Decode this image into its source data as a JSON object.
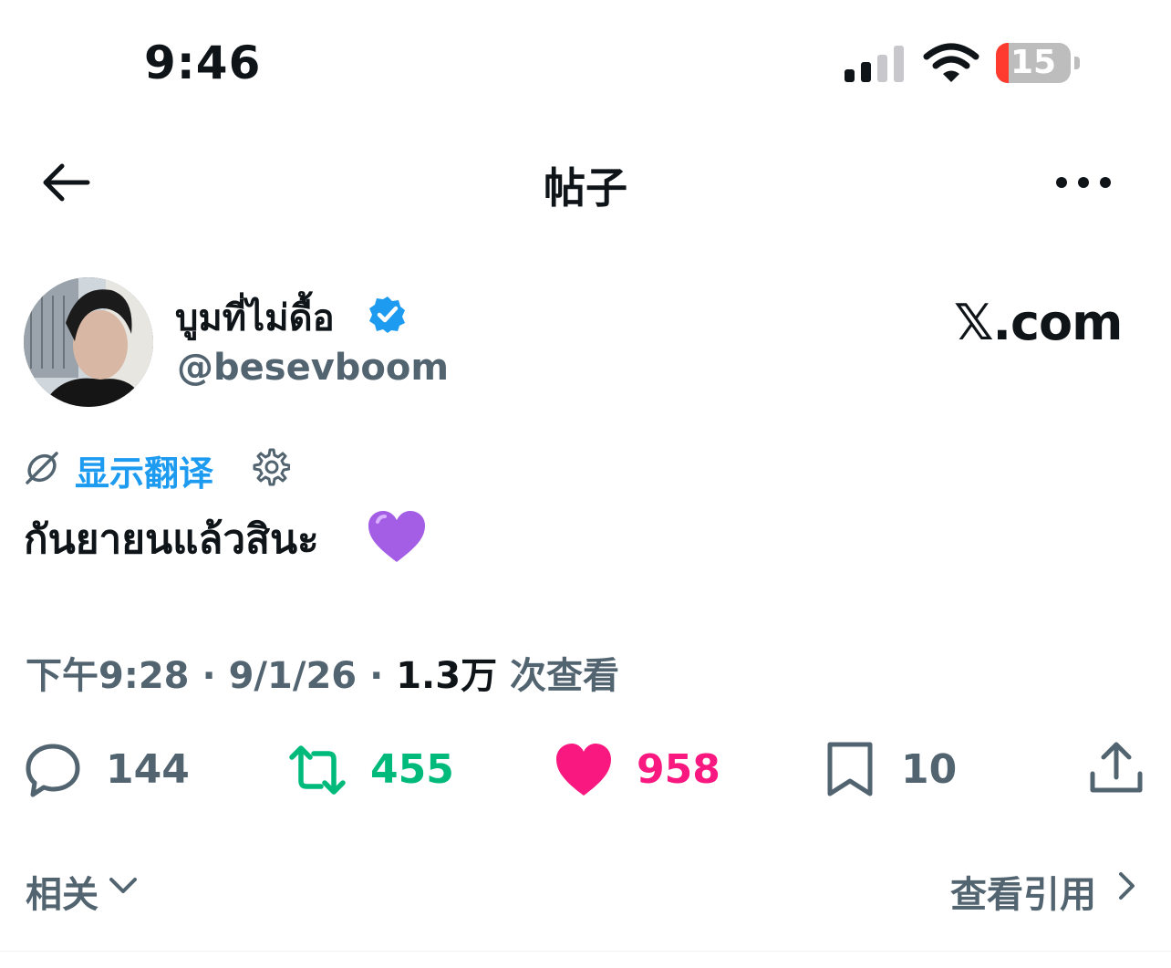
{
  "status_bar": {
    "time": "9:46",
    "battery": "15"
  },
  "nav": {
    "title": "帖子"
  },
  "author": {
    "name": "บูมที่ไม่ดื้อ",
    "handle": "@besevboom",
    "verified": true
  },
  "watermark": "𝕏.com",
  "translate": {
    "label": "显示翻译"
  },
  "post": {
    "text": "กันยายนแล้วสินะ"
  },
  "meta": {
    "time": "下午9:28",
    "sep": "·",
    "date": "9/1/26",
    "views_count": "1.3万",
    "views_label": "次查看"
  },
  "actions": {
    "replies": "144",
    "reposts": "455",
    "likes": "958",
    "bookmarks": "10"
  },
  "footer": {
    "related": "相关",
    "view_quotes": "查看引用"
  },
  "colors": {
    "accent": "#1d9bf0",
    "repost": "#00ba7c",
    "like": "#f91880",
    "muted": "#536471"
  }
}
